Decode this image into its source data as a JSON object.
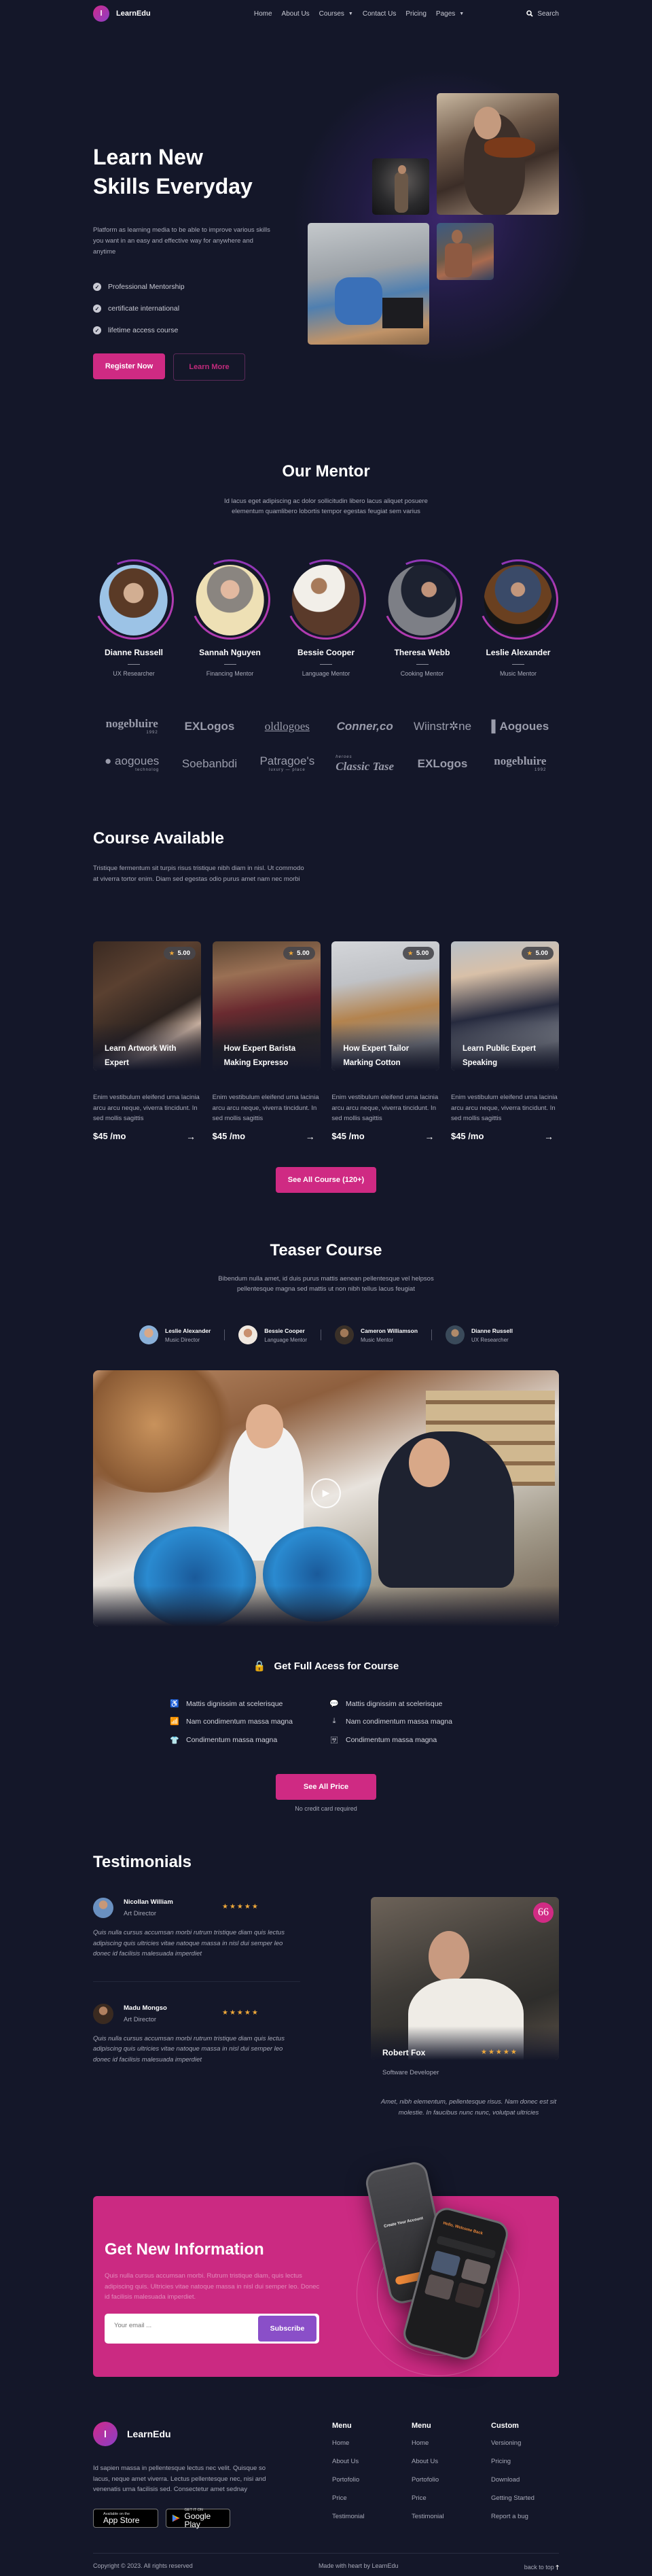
{
  "nav": {
    "brand": "LearnEdu",
    "brand_initial": "l",
    "links": [
      {
        "label": "Home",
        "dropdown": false
      },
      {
        "label": "About Us",
        "dropdown": false
      },
      {
        "label": "Courses",
        "dropdown": true
      },
      {
        "label": "Contact Us",
        "dropdown": false
      },
      {
        "label": "Pricing",
        "dropdown": false
      },
      {
        "label": "Pages",
        "dropdown": true
      }
    ],
    "search_label": "Search"
  },
  "hero": {
    "title_line1": "Learn New",
    "title_line2": "Skills Everyday",
    "description": "Platform as learning media to be able to improve various skills you want in an easy and effective way for anywhere and anytime",
    "checks": [
      "Professional Mentorship",
      "certificate international",
      "lifetime access course"
    ],
    "register_label": "Register Now",
    "learn_more_label": "Learn More"
  },
  "mentor": {
    "title": "Our Mentor",
    "subtitle": "Id lacus eget adipiscing ac dolor sollicitudin libero lacus aliquet posuere elementum quamlibero lobortis tempor egestas feugiat sem varius",
    "items": [
      {
        "name": "Dianne Russell",
        "role": "UX Researcher"
      },
      {
        "name": "Sannah Nguyen",
        "role": "Financing Mentor"
      },
      {
        "name": "Bessie Cooper",
        "role": "Language Mentor"
      },
      {
        "name": "Theresa Webb",
        "role": "Cooking Mentor"
      },
      {
        "name": "Leslie Alexander",
        "role": "Music Mentor"
      }
    ]
  },
  "partners": [
    {
      "name": "nogebluire",
      "sub": "1992"
    },
    {
      "name": "EXLogos",
      "sub": ""
    },
    {
      "name": "oldlogoes",
      "sub": ""
    },
    {
      "name": "Conner,co",
      "sub": ""
    },
    {
      "name": "Wiinstr✲ne",
      "sub": ""
    },
    {
      "name": "Aogoues",
      "sub": ""
    },
    {
      "name": "aogoues",
      "sub": "technolog"
    },
    {
      "name": "Soebanbdi",
      "sub": ""
    },
    {
      "name": "Patragoe's",
      "sub": "luxury — place"
    },
    {
      "name": "Classic Tase",
      "sub": "heroes"
    },
    {
      "name": "EXLogos",
      "sub": ""
    },
    {
      "name": "nogebluire",
      "sub": "1992"
    }
  ],
  "courses": {
    "title": "Course Available",
    "subtitle": "Tristique fermentum sit turpis risus tristique nibh diam in nisl. Ut commodo at viverra tortor enim. Diam sed egestas odio purus amet nam nec morbi",
    "items": [
      {
        "title": "Learn Artwork With Expert",
        "rating": "5.00",
        "desc": "Enim vestibulum eleifend urna lacinia arcu arcu neque, viverra tincidunt. In sed mollis sagittis",
        "price": "$45 /mo"
      },
      {
        "title": "How Expert Barista Making Expresso",
        "rating": "5.00",
        "desc": "Enim vestibulum eleifend urna lacinia arcu arcu neque, viverra tincidunt. In sed mollis sagittis",
        "price": "$45 /mo"
      },
      {
        "title": "How Expert Tailor Marking Cotton",
        "rating": "5.00",
        "desc": "Enim vestibulum eleifend urna lacinia arcu arcu neque, viverra tincidunt. In sed mollis sagittis",
        "price": "$45 /mo"
      },
      {
        "title": "Learn Public Expert Speaking",
        "rating": "5.00",
        "desc": "Enim vestibulum eleifend urna lacinia arcu arcu neque, viverra tincidunt. In sed mollis sagittis",
        "price": "$45 /mo"
      }
    ],
    "see_all_label": "See All Course (120+)"
  },
  "teaser": {
    "title": "Teaser Course",
    "subtitle": "Bibendum nulla amet, id duis purus mattis aenean pellentesque vel helpsos pellentesque magna sed mattis ut non nibh tellus lacus feugiat",
    "teachers": [
      {
        "name": "Leslie Alexander",
        "role": "Music Director"
      },
      {
        "name": "Bessie Cooper",
        "role": "Language Mentor"
      },
      {
        "name": "Cameron Williamson",
        "role": "Music Mentor"
      },
      {
        "name": "Dianne Russell",
        "role": "UX Researcher"
      }
    ],
    "access_title": "Get Full Acess for Course",
    "features": [
      {
        "icon": "wheelchair-icon",
        "glyph": "♿",
        "label": "Mattis dignissim at scelerisque"
      },
      {
        "icon": "chat-icon",
        "glyph": "💬",
        "label": "Mattis dignissim at scelerisque"
      },
      {
        "icon": "wifi-icon",
        "glyph": "📶",
        "label": "Nam condimentum massa magna"
      },
      {
        "icon": "download-icon",
        "glyph": "⤓",
        "label": "Nam condimentum massa magna"
      },
      {
        "icon": "shirt-icon",
        "glyph": "👕",
        "label": "Condimentum massa magna"
      },
      {
        "icon": "translate-icon",
        "glyph": "🈂",
        "label": "Condimentum massa magna"
      }
    ],
    "price_label": "See All Price",
    "note": "No credit card required"
  },
  "testimonials": {
    "title": "Testimonials",
    "items": [
      {
        "name": "Nicollan William",
        "role": "Art Director",
        "stars": "★★★★★",
        "quote": "Quis nulla cursus accumsan morbi rutrum tristique diam quis lectus adipiscing quis ultricies vitae natoque massa in nisl dui semper leo donec id facilisis malesuada imperdiet"
      },
      {
        "name": "Madu Mongso",
        "role": "Art Director",
        "stars": "★★★★★",
        "quote": "Quis nulla cursus accumsan morbi rutrum tristique diam quis lectus adipiscing quis ultricies vitae natoque massa in nisl dui semper leo donec id facilisis malesuada imperdiet"
      }
    ],
    "featured": {
      "name": "Robert Fox",
      "role": "Software Developer",
      "stars": "★★★★★",
      "quote_mark": "66",
      "quote": "Amet, nibh elementum, pellentesque risus. Nam donec est sit molestie. In faucibus nunc nunc, volutpat ultricies"
    }
  },
  "newsletter": {
    "title": "Get New Information",
    "description": "Quis nulla cursus accumsan morbi. Rutrum tristique diam, quis lectus adipiscing quis. Ultricies vitae natoque massa in nisl dui semper leo. Donec id facilisis malesuada imperdiet.",
    "email_placeholder": "Your email ...",
    "subscribe_label": "Subscribe"
  },
  "footer": {
    "brand": "LearnEdu",
    "brand_initial": "l",
    "description": "Id sapien massa in pellentesque lectus nec velit. Quisque so lacus, neque amet viverra. Lectus pellentesque nec, nisi and venenatis urna facilisis sed. Consectetur amet sednay",
    "app_store": {
      "line1": "Available on the",
      "line2": "App Store"
    },
    "google_play": {
      "line1": "GET IT ON",
      "line2": "Google Play"
    },
    "columns": [
      {
        "title": "Menu",
        "links": [
          "Home",
          "About Us",
          "Portofolio",
          "Price",
          "Testimonial"
        ]
      },
      {
        "title": "Menu",
        "links": [
          "Home",
          "About Us",
          "Portofolio",
          "Price",
          "Testimonial"
        ]
      },
      {
        "title": "Custom",
        "links": [
          "Versioning",
          "Pricing",
          "Download",
          "Getting Started",
          "Report a bug"
        ]
      }
    ],
    "copyright": "Copyright © 2023. All rights reserved",
    "made_with": "Made with heart by LearnEdu",
    "back_to_top": "back to top"
  },
  "colors": {
    "accent": "#cf2a83",
    "background": "#141729",
    "subscribe": "#8a4fc8",
    "star": "#f0a93a"
  }
}
